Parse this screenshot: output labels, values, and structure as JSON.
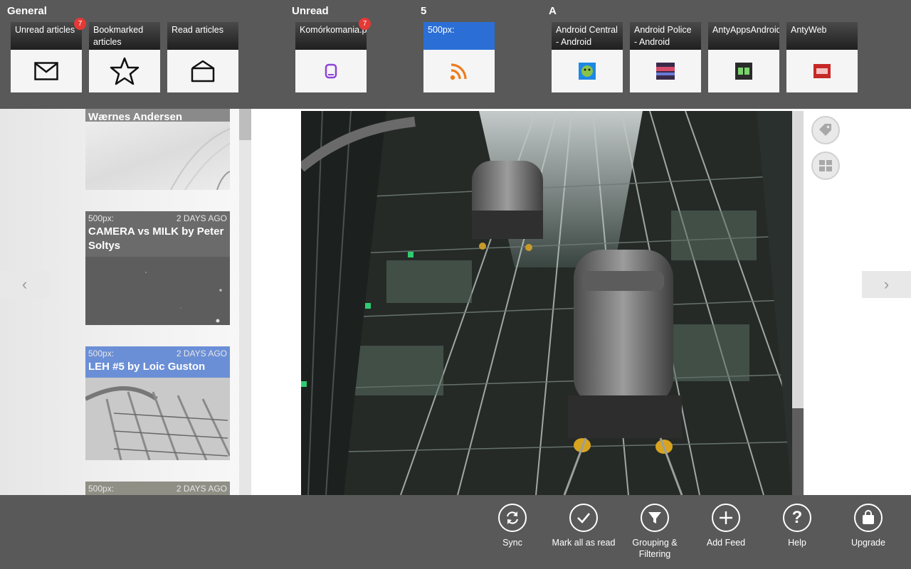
{
  "groups": {
    "general": "General",
    "unread": "Unread",
    "five": "5",
    "a": "A"
  },
  "tiles": {
    "unread_articles": {
      "label": "Unread articles",
      "badge": "7"
    },
    "bookmarked": {
      "label": "Bookmarked articles"
    },
    "read_articles": {
      "label": "Read articles"
    },
    "komorkomania": {
      "label": "Komórkomania.p",
      "badge": "7"
    },
    "px500": {
      "label": "500px:"
    },
    "android_central": {
      "label": "Android Central - Android"
    },
    "android_police": {
      "label": "Android Police - Android"
    },
    "antyapps": {
      "label": "AntyAppsAndroid"
    },
    "antyweb": {
      "label": "AntyWeb"
    }
  },
  "articles": {
    "top": {
      "title": "Wærnes Andersen"
    },
    "camera": {
      "source": "500px:",
      "age": "2 DAYS AGO",
      "title": "CAMERA vs MILK by Peter Soltys"
    },
    "leh": {
      "source": "500px:",
      "age": "2 DAYS AGO",
      "title": "LEH #5 by Loic Guston"
    },
    "bottom": {
      "source": "500px:",
      "age": "2 DAYS AGO"
    }
  },
  "nav": {
    "prev": "‹",
    "next": "›"
  },
  "side_buttons": {
    "tag": "tag-icon",
    "layout": "grid-icon"
  },
  "appbar": {
    "sync": "Sync",
    "mark_all": "Mark all as read",
    "grouping": "Grouping & Filtering",
    "add_feed": "Add Feed",
    "help": "Help",
    "upgrade": "Upgrade"
  },
  "colors": {
    "bar": "#595959",
    "accent_blue": "#2b6fd6",
    "badge": "#e53935"
  }
}
